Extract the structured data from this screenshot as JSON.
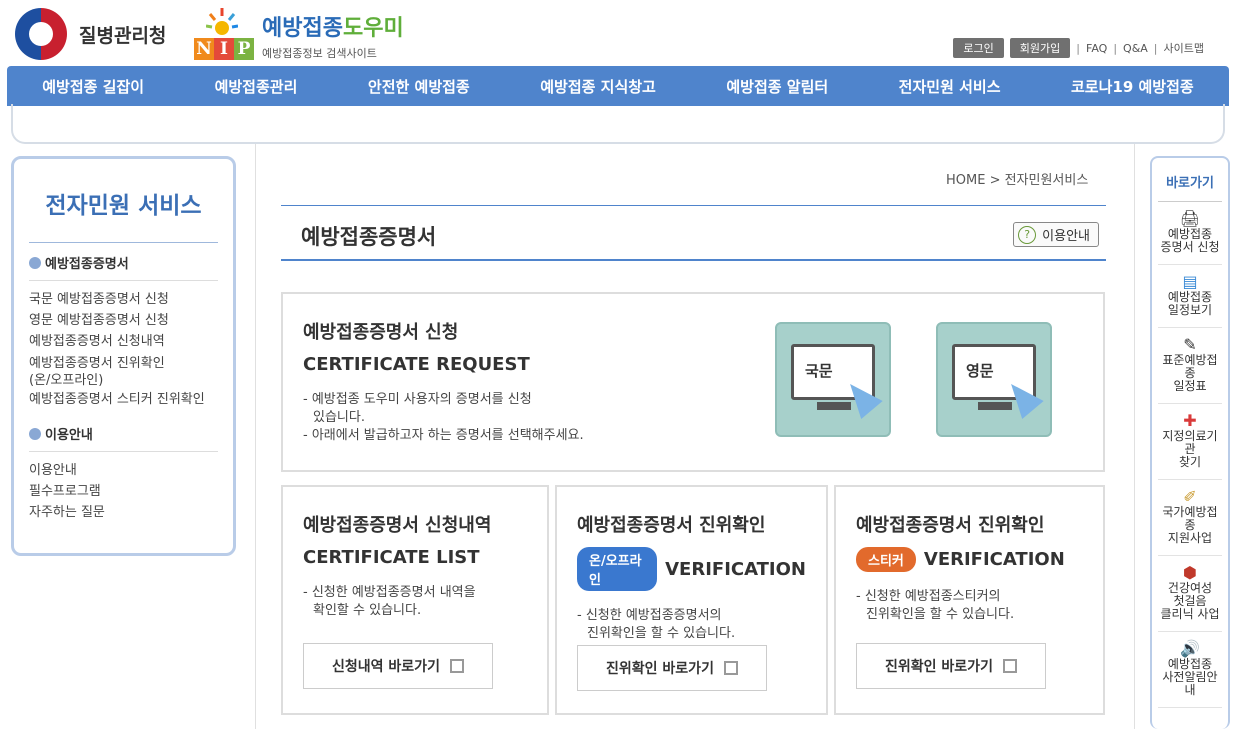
{
  "header": {
    "agency": "질병관리청",
    "nip_letters": [
      "N",
      "I",
      "P"
    ],
    "site_name_a": "예방접종",
    "site_name_b": "도우미",
    "site_sub": "예방접종정보 검색사이트",
    "util": {
      "login": "로그인",
      "join": "회원가입",
      "faq": "FAQ",
      "qa": "Q&A",
      "sitemap": "사이트맵"
    }
  },
  "gnb": [
    "예방접종 길잡이",
    "예방접종관리",
    "안전한 예방접종",
    "예방접종 지식창고",
    "예방접종 알림터",
    "전자민원 서비스",
    "코로나19 예방접종"
  ],
  "lnb": {
    "title": "전자민원 서비스",
    "group1": "예방접종증명서",
    "items1": [
      "국문 예방접종증명서 신청",
      "영문 예방접종증명서 신청",
      "예방접종증명서 신청내역",
      "예방접종증명서 진위확인",
      "(온/오프라인)",
      "예방접종증명서 스티커 진위확인"
    ],
    "group2": "이용안내",
    "items2": [
      "이용안내",
      "필수프로그램",
      "자주하는 질문"
    ]
  },
  "breadcrumb": "HOME > 전자민원서비스",
  "page_title": "예방접종증명서",
  "help_label": "이용안내",
  "request": {
    "title": "예방접종증명서 신청",
    "eng": "CERTIFICATE REQUEST",
    "desc1": "- 예방접종 도우미 사용자의 증명서를 신청",
    "desc2": "  있습니다.",
    "desc3": "- 아래에서 발급하고자 하는 증명서를 선택해주세요.",
    "kr": "국문",
    "en": "영문"
  },
  "cards": [
    {
      "title": "예방접종증명서 신청내역",
      "eng": "CERTIFICATE LIST",
      "badge": "",
      "desc1": "- 신청한 예방접종증명서 내역을",
      "desc2": "  확인할 수 있습니다.",
      "link": "신청내역 바로가기"
    },
    {
      "title": "예방접종증명서 진위확인",
      "eng": "VERIFICATION",
      "badge": "온/오프라인",
      "desc1": "- 신청한 예방접종증명서의",
      "desc2": "  진위확인을 할 수 있습니다.",
      "link": "진위확인 바로가기"
    },
    {
      "title": "예방접종증명서 진위확인",
      "eng": "VERIFICATION",
      "badge": "스티커",
      "desc1": "- 신청한 예방접종스티커의",
      "desc2": "  진위확인을 할 수 있습니다.",
      "link": "진위확인 바로가기"
    }
  ],
  "quick": {
    "title": "바로가기",
    "items": [
      {
        "l1": "예방접종",
        "l2": "증명서 신청",
        "l3": ""
      },
      {
        "l1": "예방접종",
        "l2": "일정보기",
        "l3": ""
      },
      {
        "l1": "표준예방접종",
        "l2": "일정표",
        "l3": ""
      },
      {
        "l1": "지정의료기관",
        "l2": "찾기",
        "l3": ""
      },
      {
        "l1": "국가예방접종",
        "l2": "지원사업",
        "l3": ""
      },
      {
        "l1": "건강여성",
        "l2": "첫걸음",
        "l3": "클리닉 사업"
      },
      {
        "l1": "예방접종",
        "l2": "사전알림안내",
        "l3": ""
      }
    ]
  },
  "colors": {
    "accent": "#4f84cc",
    "online_badge": "#3a78cf",
    "sticker_badge": "#e26a2c"
  }
}
